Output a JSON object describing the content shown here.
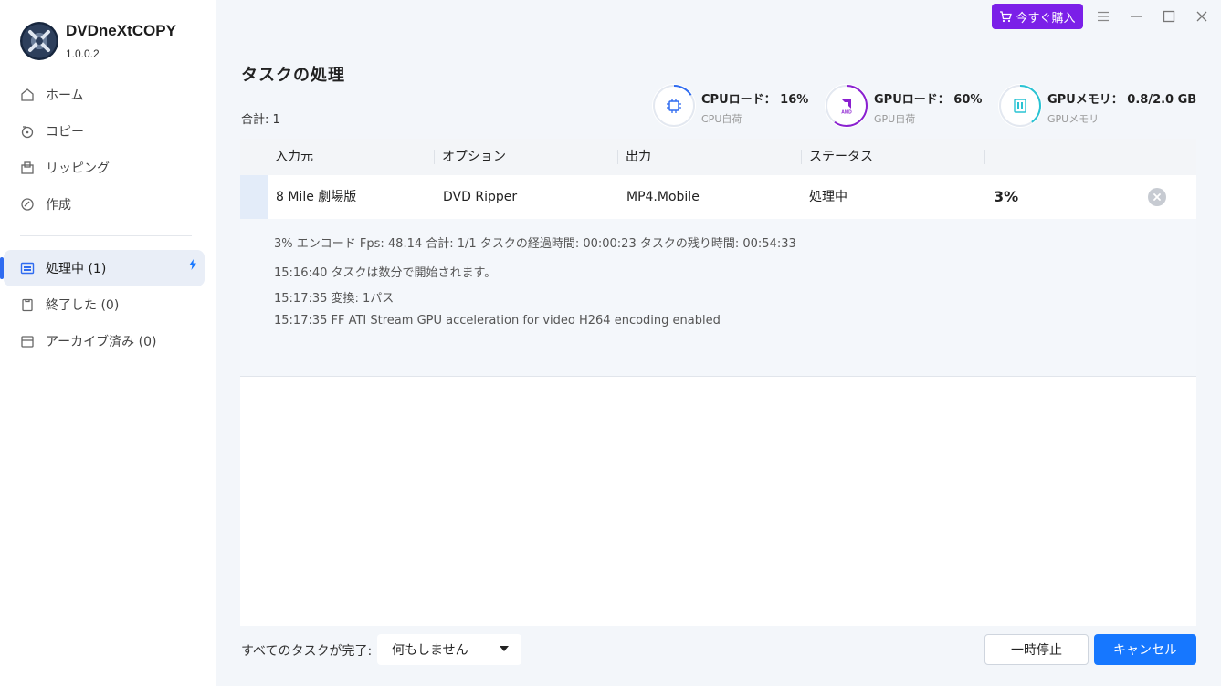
{
  "app": {
    "name": "DVDneXtCOPY",
    "version": "1.0.0.2",
    "buy_label": "今すぐ購入"
  },
  "sidebar": {
    "items": [
      {
        "label": "ホーム",
        "icon": "home-icon"
      },
      {
        "label": "コピー",
        "icon": "copy-icon"
      },
      {
        "label": "リッピング",
        "icon": "ripping-icon"
      },
      {
        "label": "作成",
        "icon": "create-icon"
      }
    ],
    "tasks": [
      {
        "label": "処理中 (1)",
        "icon": "processing-icon",
        "active": true
      },
      {
        "label": "終了した (0)",
        "icon": "finished-icon"
      },
      {
        "label": "アーカイブ済み (0)",
        "icon": "archive-icon"
      }
    ]
  },
  "header": {
    "title": "タスクの処理",
    "total": "合計: 1"
  },
  "stats": {
    "cpu": {
      "label": "CPUロード：",
      "value": "16%",
      "sub": "CPU自荷",
      "percent": 16,
      "color": "#2f6bf0"
    },
    "gpu": {
      "label": "GPUロード：",
      "value": "60%",
      "sub": "GPU自荷",
      "percent": 60,
      "color": "#8a1fd0"
    },
    "mem": {
      "label": "GPUメモリ：",
      "value": "0.8/2.0 GB",
      "sub": "GPUメモリ",
      "percent": 40,
      "color": "#29c3d3"
    }
  },
  "table": {
    "columns": [
      "入力元",
      "オプション",
      "出力",
      "ステータス"
    ],
    "rows": [
      {
        "input": "8 Mile 劇場版",
        "option": "DVD Ripper",
        "output": "MP4.Mobile",
        "status": "処理中",
        "progress": "3%"
      }
    ],
    "details": {
      "summary": "3%  エンコード Fps: 48.14  合計: 1/1  タスクの経過時間: 00:00:23  タスクの残り時間: 00:54:33",
      "logs": [
        "15:16:40  タスクは数分で開始されます。",
        "15:17:35  変換: 1パス",
        "15:17:35  FF ATI Stream GPU acceleration for video H264 encoding enabled"
      ]
    }
  },
  "footer": {
    "label": "すべてのタスクが完了:",
    "select_value": "何もしません",
    "pause_label": "一時停止",
    "cancel_label": "キャンセル"
  }
}
